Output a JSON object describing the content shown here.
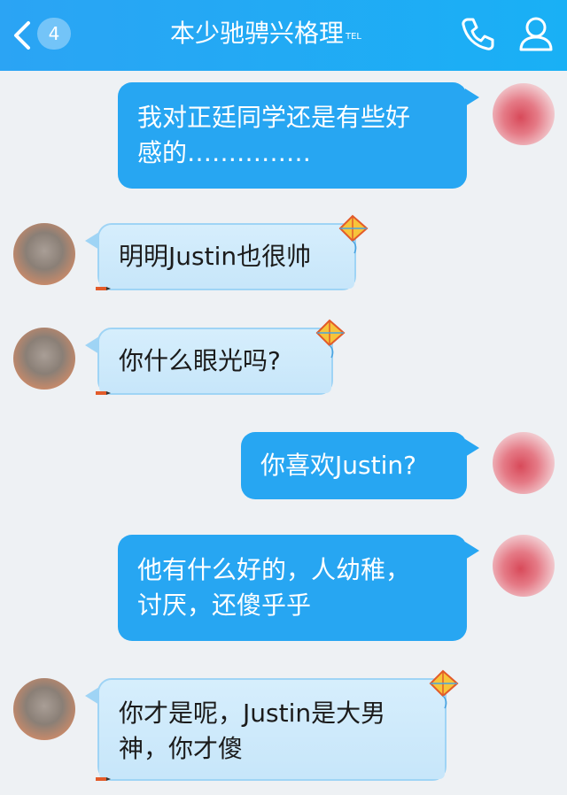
{
  "header": {
    "back_icon": "chevron-left-icon",
    "unread_count": "4",
    "title": "本少驰骋兴格理",
    "tel_tag": "TEL",
    "phone_icon": "phone-icon",
    "profile_icon": "user-icon",
    "bar_color": "#1fabf5"
  },
  "messages": [
    {
      "sender": "me",
      "text": "我对正廷同学还是有些好\n感的……………"
    },
    {
      "sender": "friend",
      "text": "明明Justin也很帅"
    },
    {
      "sender": "friend",
      "text": "你什么眼光吗?"
    },
    {
      "sender": "me",
      "text": "你喜欢Justin?"
    },
    {
      "sender": "me",
      "text": "他有什么好的，人幼稚，\n讨厌，还傻乎乎"
    },
    {
      "sender": "friend",
      "text": "你才是呢，Justin是大男\n神，你才傻"
    }
  ],
  "colors": {
    "my_bubble": "#27a6f2",
    "friend_bubble": "#c8e7fb",
    "background": "#eef1f4"
  }
}
